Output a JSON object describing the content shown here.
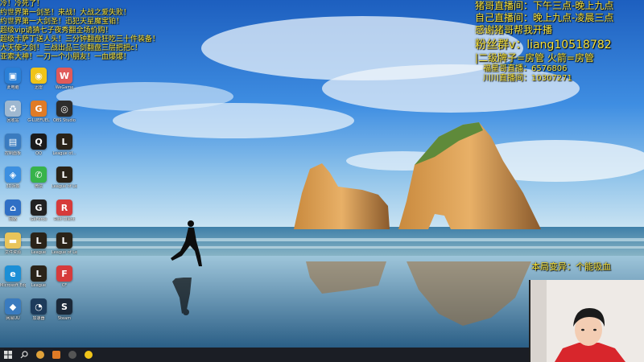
{
  "stream_overlay_left": [
    "冷！冷死了！",
    "约世界第一剑圣！来战！大战之爱失败！",
    "约世界第一大剑圣！迅犯天星魔宝铂！",
    "超级vip请猜七子夜秀翻全场价购！",
    "超级卡萨丁送人头！三分钟翻盘狂吃三十件装备！",
    "大天使之剑！三战出品三剑翻盘三层把把c！",
    "亚索大神！一刀一个小朋友！一血爆爆！"
  ],
  "stream_overlay_right": {
    "schedule_1": "猪哥直播间：下午三点-晚上九点",
    "schedule_2": "自己直播间：晚上九点-凌晨三点",
    "thanks": "感谢猪哥帮我开播",
    "fans_group": "粉丝群v：liang10518782",
    "badge": "|二级牌子=房管 火箭=房管",
    "room_1": "福星哥直播：6576806",
    "room_2": "川川直播间：10307271"
  },
  "hero_text": "本局变异：个能吸血",
  "desktop_icons": [
    {
      "label": "此电脑",
      "icon": "computer-icon",
      "color": "#2a7fd6",
      "glyph": "▣"
    },
    {
      "label": "迅雷",
      "icon": "thunder-icon",
      "color": "#f0c419",
      "glyph": "◉"
    },
    {
      "label": "WeGame",
      "icon": "wegame-icon",
      "color": "#e05a5a",
      "glyph": "W"
    },
    {
      "label": "回收站",
      "icon": "recycle-bin-icon",
      "color": "#9fb8d0",
      "glyph": "♻"
    },
    {
      "label": "G-LUEFUEL",
      "icon": "game-icon",
      "color": "#e07b26",
      "glyph": "G"
    },
    {
      "label": "OBS Studio",
      "icon": "obs-icon",
      "color": "#2d2d2d",
      "glyph": "◎"
    },
    {
      "label": "控制面板",
      "icon": "control-panel-icon",
      "color": "#3a7bbf",
      "glyph": "▤"
    },
    {
      "label": "QQ",
      "icon": "qq-icon",
      "color": "#1b1b1b",
      "glyph": "Q"
    },
    {
      "label": "League of...",
      "icon": "league-icon",
      "color": "#2a2318",
      "glyph": "L"
    },
    {
      "label": "3D对象",
      "icon": "cube-icon",
      "color": "#3c8fe0",
      "glyph": "◈"
    },
    {
      "label": "微信",
      "icon": "wechat-icon",
      "color": "#37b34a",
      "glyph": "✆"
    },
    {
      "label": "League of Legends",
      "icon": "league-icon",
      "color": "#2a2318",
      "glyph": "L"
    },
    {
      "label": "网络",
      "icon": "network-icon",
      "color": "#2f6fc5",
      "glyph": "⌂"
    },
    {
      "label": "GeForce",
      "icon": "geforce-icon",
      "color": "#222",
      "glyph": "G"
    },
    {
      "label": "Riot Client",
      "icon": "riot-icon",
      "color": "#d63b3b",
      "glyph": "R"
    },
    {
      "label": "文件资源",
      "icon": "folder-icon",
      "color": "#e9c45a",
      "glyph": "▬"
    },
    {
      "label": "League",
      "icon": "league-icon",
      "color": "#2a2318",
      "glyph": "L"
    },
    {
      "label": "League of Legends",
      "icon": "league-icon",
      "color": "#2a2318",
      "glyph": "L"
    },
    {
      "label": "Microsoft Edge",
      "icon": "edge-icon",
      "color": "#1b8fd6",
      "glyph": "e"
    },
    {
      "label": "League",
      "icon": "league-icon",
      "color": "#2a2318",
      "glyph": "L"
    },
    {
      "label": "CF",
      "icon": "cf-icon",
      "color": "#d63b3b",
      "glyph": "F"
    },
    {
      "label": "网易UU",
      "icon": "uu-icon",
      "color": "#3a7bbf",
      "glyph": "◆"
    },
    {
      "label": "加速器",
      "icon": "booster-icon",
      "color": "#1d3b5b",
      "glyph": "◔"
    },
    {
      "label": "Steam",
      "icon": "steam-icon",
      "color": "#1b2838",
      "glyph": "S"
    }
  ],
  "taskbar": [
    {
      "icon": "windows-start-icon"
    },
    {
      "icon": "search-icon"
    },
    {
      "icon": "chrome-icon"
    },
    {
      "icon": "app-icon"
    },
    {
      "icon": "obs-icon"
    },
    {
      "icon": "game-icon"
    }
  ],
  "colors": {
    "overlay_text": "#f6e13a",
    "taskbar": "#1b1e25"
  }
}
